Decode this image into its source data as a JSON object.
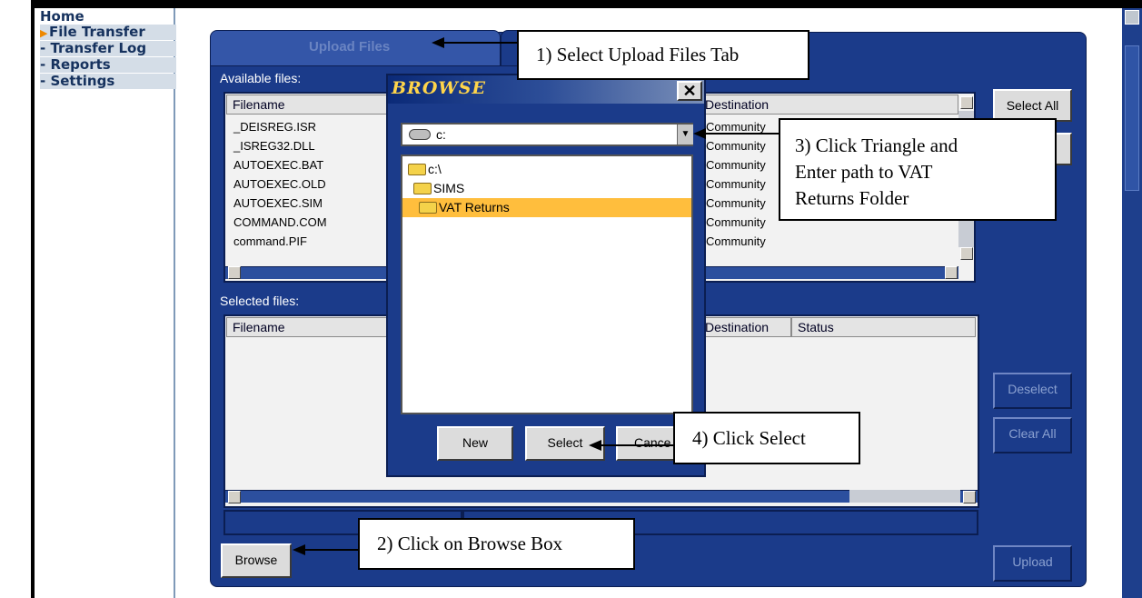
{
  "nav": {
    "items": [
      {
        "label": "Home",
        "prefix": ""
      },
      {
        "label": "File Transfer",
        "prefix": "▶"
      },
      {
        "label": "- Transfer Log",
        "prefix": ""
      },
      {
        "label": "- Reports",
        "prefix": ""
      },
      {
        "label": "- Settings",
        "prefix": ""
      }
    ]
  },
  "tabs": {
    "upload": "Upload Files"
  },
  "available": {
    "label": "Available files:",
    "col_filename": "Filename",
    "col_destination": "Destination",
    "rows": [
      {
        "file": "_DEISREG.ISR",
        "dest": "Community"
      },
      {
        "file": "_ISREG32.DLL",
        "dest": "Community"
      },
      {
        "file": "AUTOEXEC.BAT",
        "dest": "Community"
      },
      {
        "file": "AUTOEXEC.OLD",
        "dest": "Community"
      },
      {
        "file": "AUTOEXEC.SIM",
        "dest": "Community"
      },
      {
        "file": "COMMAND.COM",
        "dest": "Community"
      },
      {
        "file": "command.PIF",
        "dest": "Community"
      }
    ]
  },
  "selected": {
    "label": "Selected files:",
    "col_filename": "Filename",
    "col_destination": "Destination",
    "col_status": "Status"
  },
  "buttons": {
    "select_all": "Select All",
    "deselect": "Deselect",
    "clear_all": "Clear All",
    "browse": "Browse",
    "upload": "Upload"
  },
  "dialog": {
    "title": "BROWSE",
    "close": "✕",
    "drive": "c:",
    "folders": [
      "c:\\",
      "SIMS",
      "VAT Returns"
    ],
    "new": "New",
    "select": "Select",
    "cancel": "Cance"
  },
  "callouts": {
    "c1": "1) Select Upload Files Tab",
    "c2": "2) Click on Browse Box",
    "c3_line1": "3) Click Triangle and",
    "c3_line2": "Enter path to VAT",
    "c3_line3": "Returns Folder",
    "c4": "4) Click Select"
  }
}
